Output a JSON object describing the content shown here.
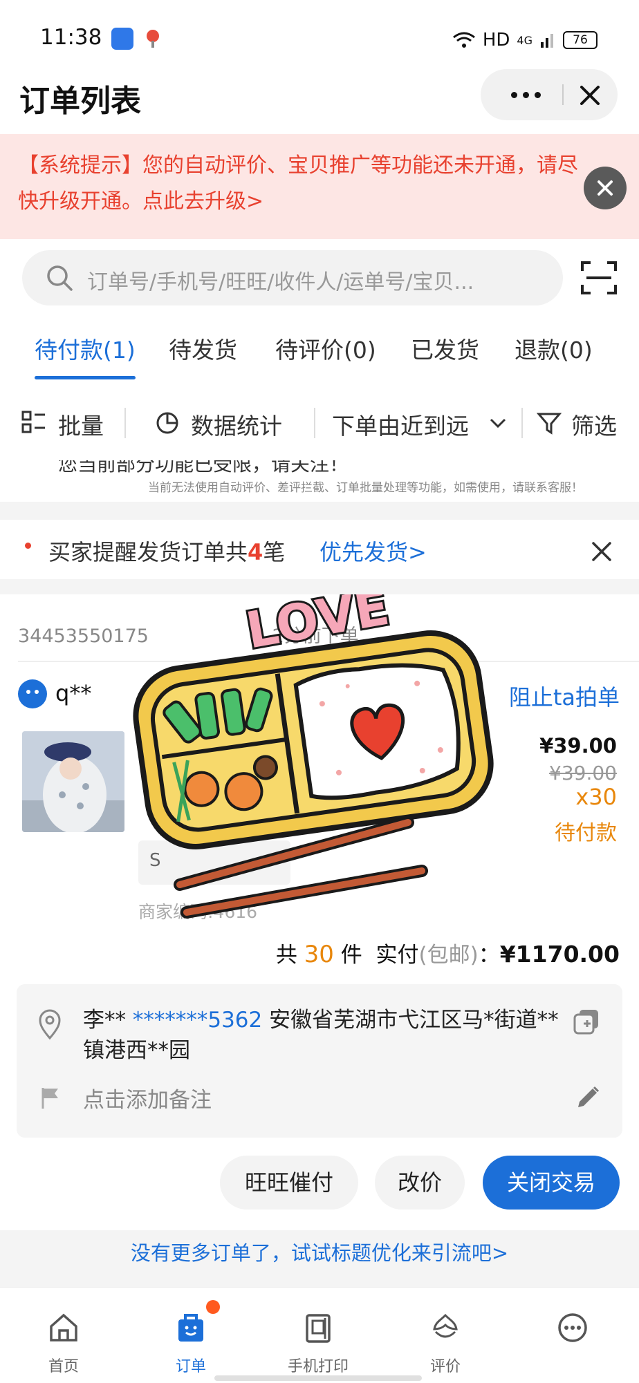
{
  "status_bar": {
    "time": "11:38",
    "network": "HD",
    "signal": "4G",
    "battery": "76"
  },
  "header": {
    "title": "订单列表",
    "more_icon": "more-dots-icon",
    "close_icon": "close-icon"
  },
  "banner": {
    "text": "【系统提示】您的自动评价、宝贝推广等功能还未开通，请尽快升级开通。点此去升级>",
    "color": "#e8412f",
    "background": "#fde6e4"
  },
  "search": {
    "placeholder": "订单号/手机号/旺旺/收件人/运单号/宝贝..."
  },
  "tabs": [
    "待付款(1)",
    "待发货",
    "待评价(0)",
    "已发货",
    "退款(0)"
  ],
  "toolbar": {
    "batch": "批量",
    "stats": "数据统计",
    "sort": "下单由近到远",
    "filter": "筛选"
  },
  "warning": {
    "partial": "您当前部分功能已受限，请关注！",
    "sub": "当前无法使用自动评价、差评拦截、订单批量处理等功能，如需使用，请联系客服！"
  },
  "remind": {
    "prefix": "买家提醒发货订单共",
    "count": "4",
    "suffix": "笔",
    "link": "优先发货>"
  },
  "order": {
    "id_text": "34453550175",
    "time_text": "2分",
    "time_suffix": "前下单",
    "buyer": "q**",
    "block_action": "阻止ta拍单",
    "price": "¥39.00",
    "original_price": "¥39.00",
    "quantity": "x30",
    "status": "待付款",
    "sku": "S",
    "merchant_code": "商家编码:4616",
    "total": {
      "prefix": "共",
      "count": "30",
      "unit": "件",
      "paid_label": "实付",
      "shipping": "(包邮)",
      "colon": "：",
      "amount": "¥1170.00"
    },
    "address": {
      "name": "李**",
      "phone": "*******5362",
      "address": "安徽省芜湖市弋江区马*街道**镇港西**园"
    },
    "note_placeholder": "点击添加备注",
    "actions": [
      "旺旺催付",
      "改价",
      "关闭交易"
    ]
  },
  "footer_link": "没有更多订单了，试试标题优化来引流吧>",
  "sticker_text": "LOVE",
  "nav": [
    "首页",
    "订单",
    "手机打印",
    "评价",
    ""
  ],
  "colors": {
    "accent": "#1c6fd8",
    "orange": "#e8870c",
    "red": "#e8412f"
  }
}
